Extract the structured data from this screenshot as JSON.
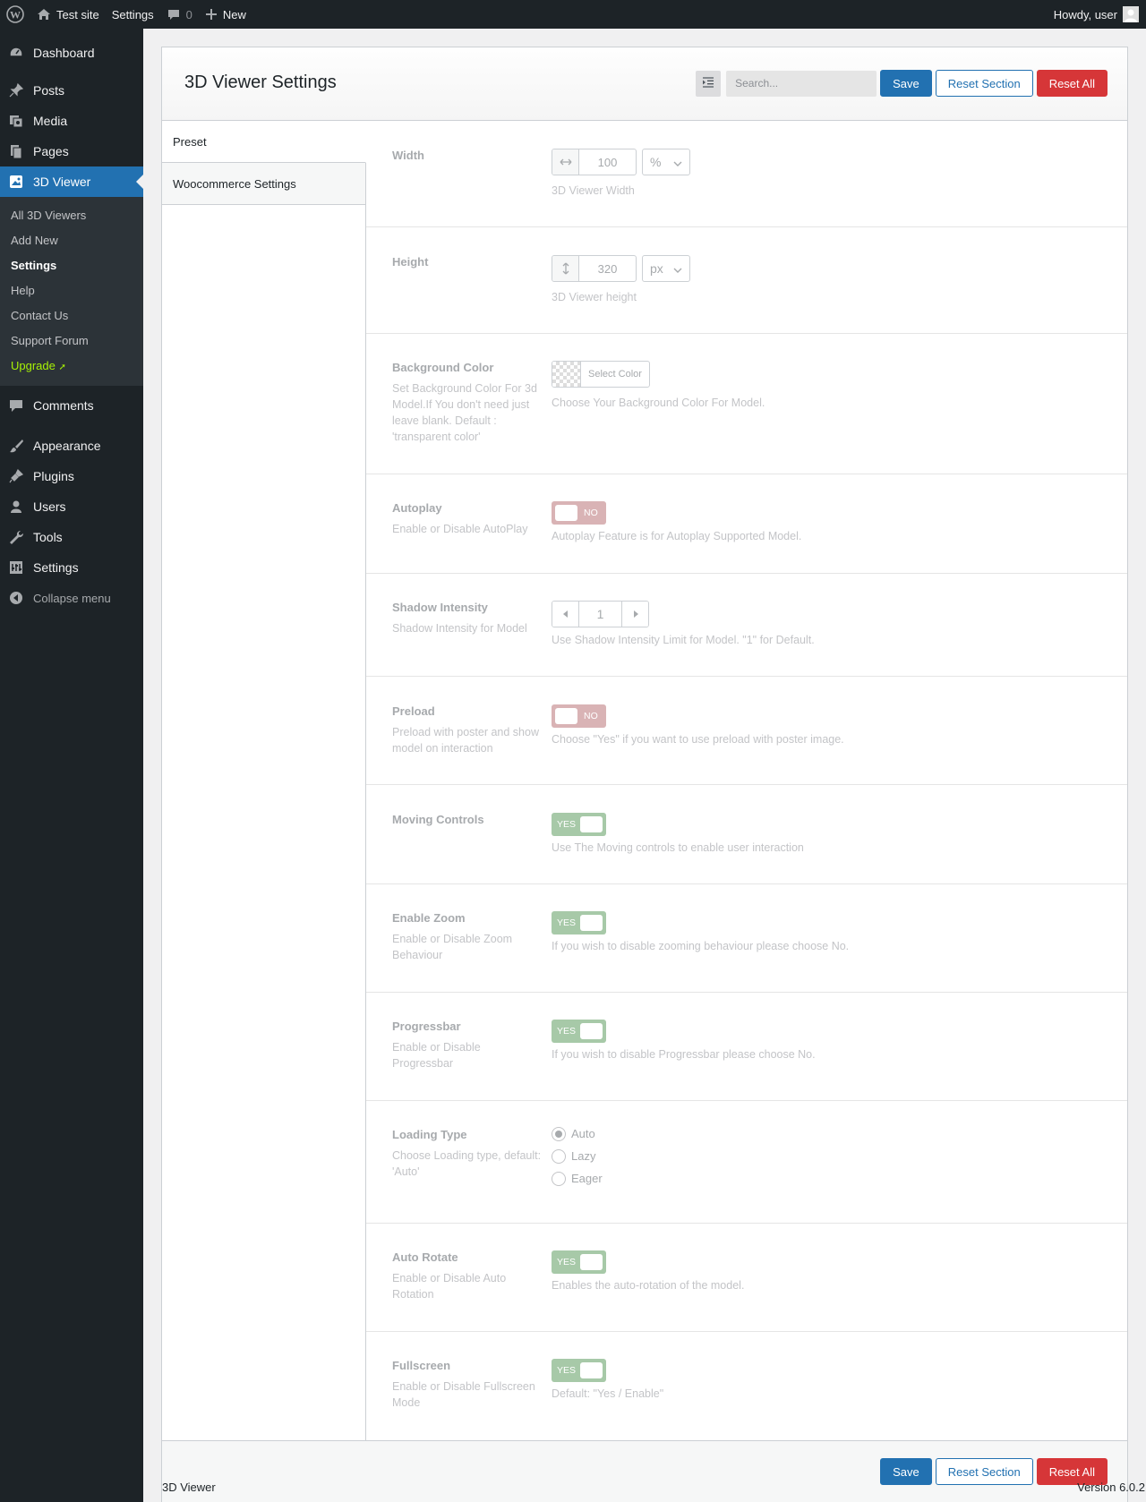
{
  "adminbar": {
    "site_name": "Test site",
    "settings_label": "Settings",
    "comments_count": "0",
    "new_label": "New",
    "howdy": "Howdy, user"
  },
  "sidebar": {
    "items": [
      {
        "label": "Dashboard",
        "icon": "dashboard-icon"
      },
      {
        "label": "Posts",
        "icon": "pin-icon"
      },
      {
        "label": "Media",
        "icon": "media-icon"
      },
      {
        "label": "Pages",
        "icon": "pages-icon"
      },
      {
        "label": "3D Viewer",
        "icon": "image-icon"
      },
      {
        "label": "Comments",
        "icon": "comment-icon"
      },
      {
        "label": "Appearance",
        "icon": "brush-icon"
      },
      {
        "label": "Plugins",
        "icon": "plugin-icon"
      },
      {
        "label": "Users",
        "icon": "user-icon"
      },
      {
        "label": "Tools",
        "icon": "wrench-icon"
      },
      {
        "label": "Settings",
        "icon": "settings-icon"
      }
    ],
    "submenu": [
      "All 3D Viewers",
      "Add New",
      "Settings",
      "Help",
      "Contact Us",
      "Support Forum",
      "Upgrade"
    ],
    "upgrade_symbol": "➚",
    "collapse": "Collapse menu"
  },
  "panel": {
    "title": "3D Viewer Settings",
    "search_placeholder": "Search...",
    "save": "Save",
    "reset_section": "Reset Section",
    "reset_all": "Reset All",
    "nav": [
      "Preset",
      "Woocommerce Settings"
    ]
  },
  "fields": {
    "width": {
      "label": "Width",
      "value": "100",
      "unit": "%",
      "desc": "3D Viewer Width"
    },
    "height": {
      "label": "Height",
      "value": "320",
      "unit": "px",
      "desc": "3D Viewer height"
    },
    "bgcolor": {
      "label": "Background Color",
      "sub": "Set Background Color For 3d Model.If You don't need just leave blank. Default : 'transparent color'",
      "button": "Select Color",
      "desc": "Choose Your Background Color For Model."
    },
    "autoplay": {
      "label": "Autoplay",
      "sub": "Enable or Disable AutoPlay",
      "state": "NO",
      "desc": "Autoplay Feature is for Autoplay Supported Model."
    },
    "shadow": {
      "label": "Shadow Intensity",
      "sub": "Shadow Intensity for Model",
      "value": "1",
      "desc": "Use Shadow Intensity Limit for Model. \"1\" for Default."
    },
    "preload": {
      "label": "Preload",
      "sub": "Preload with poster and show model on interaction",
      "state": "NO",
      "desc": "Choose \"Yes\" if you want to use preload with poster image."
    },
    "moving": {
      "label": "Moving Controls",
      "state": "YES",
      "desc": "Use The Moving controls to enable user interaction"
    },
    "zoom": {
      "label": "Enable Zoom",
      "sub": "Enable or Disable Zoom Behaviour",
      "state": "YES",
      "desc": "If you wish to disable zooming behaviour please choose No."
    },
    "progressbar": {
      "label": "Progressbar",
      "sub": "Enable or Disable Progressbar",
      "state": "YES",
      "desc": "If you wish to disable Progressbar please choose No."
    },
    "loading": {
      "label": "Loading Type",
      "sub": "Choose Loading type, default: 'Auto'",
      "options": [
        "Auto",
        "Lazy",
        "Eager"
      ],
      "selected": "Auto"
    },
    "autorotate": {
      "label": "Auto Rotate",
      "sub": "Enable or Disable Auto Rotation",
      "state": "YES",
      "desc": "Enables the auto-rotation of the model."
    },
    "fullscreen": {
      "label": "Fullscreen",
      "sub": "Enable or Disable Fullscreen Mode",
      "state": "YES",
      "desc": "Default: \"Yes / Enable\""
    }
  },
  "footer": {
    "left": "3D Viewer",
    "version": "Version 6.0.2"
  },
  "colors": {
    "primary": "#2271b1",
    "danger": "#d63638",
    "sidebar": "#1d2327",
    "upgrade": "#a7f205"
  }
}
